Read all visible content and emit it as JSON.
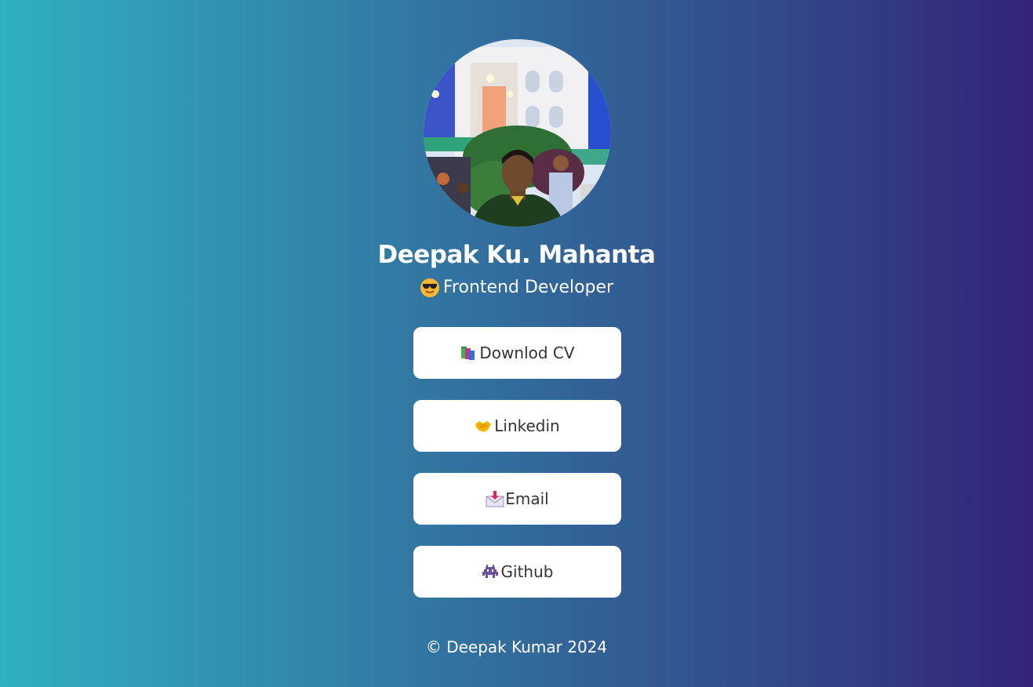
{
  "profile": {
    "name": "Deepak Ku. Mahanta",
    "role": "Frontend Developer",
    "role_icon": "smiling-face-with-sunglasses-emoji",
    "avatar_alt": "profile photo"
  },
  "links": [
    {
      "label": "Downlod CV",
      "icon": "books-emoji"
    },
    {
      "label": "Linkedin",
      "icon": "handshake-emoji"
    },
    {
      "label": "Email",
      "icon": "envelope-with-arrow-emoji"
    },
    {
      "label": "Github",
      "icon": "alien-monster-emoji"
    }
  ],
  "footer": {
    "text": "© Deepak Kumar 2024"
  },
  "colors": {
    "gradient_left": "#30b0c0",
    "gradient_right": "#33237a",
    "button_bg": "#ffffff",
    "button_text": "#333333"
  }
}
